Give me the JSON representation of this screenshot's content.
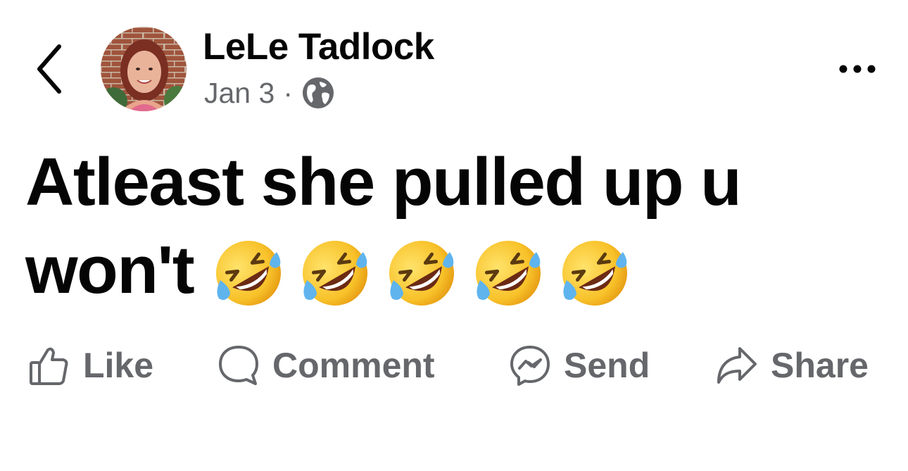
{
  "post": {
    "author_name": "LeLe Tadlock",
    "date": "Jan 3",
    "separator": "·",
    "audience_icon": "globe-icon",
    "text": "Atleast she pulled up u won't",
    "emojis": [
      "🤣",
      "🤣",
      "🤣",
      "🤣",
      "🤣"
    ]
  },
  "header": {
    "back_icon": "chevron-left-icon",
    "more_icon": "more-horizontal-icon"
  },
  "actions": [
    {
      "label": "Like",
      "icon": "thumbs-up-icon"
    },
    {
      "label": "Comment",
      "icon": "comment-bubble-icon"
    },
    {
      "label": "Send",
      "icon": "messenger-icon"
    },
    {
      "label": "Share",
      "icon": "share-arrow-icon"
    }
  ],
  "colors": {
    "text_primary": "#050505",
    "text_secondary": "#65676b",
    "background": "#ffffff"
  }
}
